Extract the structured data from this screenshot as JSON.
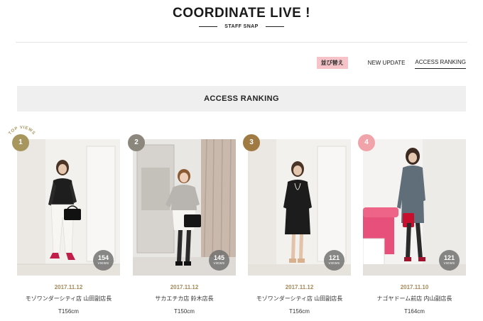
{
  "header": {
    "title": "COORDINATE LIVE !",
    "subtitle": "STAFF SNAP"
  },
  "sort": {
    "badge": "並び替え",
    "options": [
      {
        "label": "NEW UPDATE",
        "active": false
      },
      {
        "label": "ACCESS RANKING",
        "active": true
      }
    ]
  },
  "section": {
    "title": "ACCESS RANKING"
  },
  "colors": {
    "rank_gold": "#a8965f",
    "rank_gray": "#8c877d",
    "rank_brown": "#a07a43",
    "rank_pink": "#f0a4aa",
    "date_text": "#a78a5a",
    "sort_badge_bg": "#f6c4c8",
    "section_bg": "#efefef"
  },
  "cards": [
    {
      "rank": "1",
      "top_badge": "TOP VIEWS",
      "views": "154",
      "views_label": "VIEWS",
      "date": "2017.11.12",
      "shop": "モゾワンダーシティ店 山田副店長",
      "height": "T156cm"
    },
    {
      "rank": "2",
      "views": "145",
      "views_label": "VIEWS",
      "date": "2017.11.12",
      "shop": "サカエチカ店 鈴木店長",
      "height": "T150cm"
    },
    {
      "rank": "3",
      "views": "121",
      "views_label": "VIEWS",
      "date": "2017.11.12",
      "shop": "モゾワンダーシティ店 山田副店長",
      "height": "T156cm"
    },
    {
      "rank": "4",
      "views": "121",
      "views_label": "VIEWS",
      "date": "2017.11.10",
      "shop": "ナゴヤドーム前店 内山副店長",
      "height": "T164cm"
    }
  ]
}
